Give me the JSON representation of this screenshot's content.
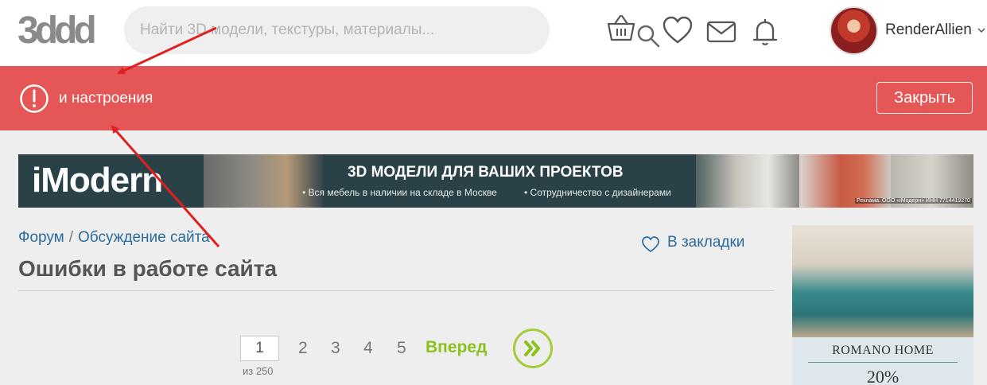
{
  "header": {
    "logo_text": "3ddd",
    "search_placeholder": "Найти 3D модели, текстуры, материалы...",
    "icons": [
      "basket-icon",
      "heart-icon",
      "mail-icon",
      "bell-icon"
    ],
    "username": "RenderAllien"
  },
  "alert": {
    "message": "и настроения",
    "close_label": "Закрыть",
    "background": "#e55656"
  },
  "banner": {
    "brand": "iModern",
    "title": "3D МОДЕЛИ ДЛЯ ВАШИХ ПРОЕКТОВ",
    "bullet1": "• Вся мебель в наличии на складе в Москве",
    "bullet2": "• Сотрудничество с дизайнерами",
    "legal": "Реклама. ООО «iМодерн» ИНН 7714419270"
  },
  "breadcrumb": {
    "items": [
      "Форум",
      "Обсуждение сайта"
    ],
    "separator": "/"
  },
  "bookmark_label": "В закладки",
  "page_title": "Ошибки в работе сайта",
  "pagination": {
    "current": "1",
    "total_label": "из 250",
    "pages": [
      "2",
      "3",
      "4",
      "5"
    ],
    "next_label": "Вперед"
  },
  "side_ad": {
    "brand": "ROMANO HOME",
    "discount": "20%"
  },
  "colors": {
    "accent_green": "#8cc21e",
    "link_blue": "#2b6b9c",
    "annotation_red": "#e02020"
  }
}
